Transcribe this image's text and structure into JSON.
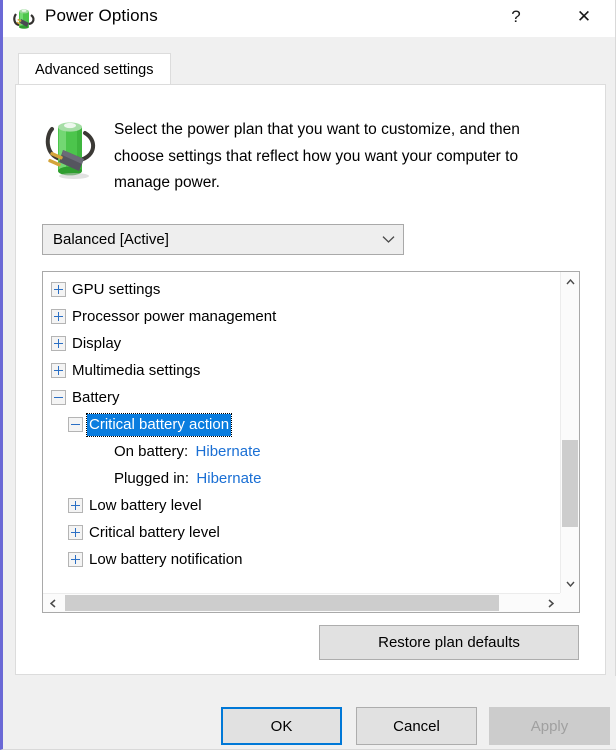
{
  "window": {
    "title": "Power Options",
    "icon": "battery-plug-icon",
    "accent_border_color": "#6b69d6",
    "caption_buttons": [
      {
        "name": "help-button",
        "glyph": "?"
      },
      {
        "name": "close-button",
        "glyph": "✕"
      }
    ]
  },
  "tabs": [
    {
      "label": "Advanced settings",
      "selected": true
    }
  ],
  "header": {
    "icon": "battery-plug-icon",
    "description": "Select the power plan that you want to customize, and then choose settings that reflect how you want your computer to manage power."
  },
  "plan_combo": {
    "value": "Balanced [Active]",
    "arrow_icon": "chevron-down-icon"
  },
  "tree": {
    "selection_color": "#0a7ddf",
    "value_link_color": "#1a6fd4",
    "items": [
      {
        "label": "GPU settings",
        "level": 0,
        "expander": "plus",
        "selected": false,
        "type": "category"
      },
      {
        "label": "Processor power management",
        "level": 0,
        "expander": "plus",
        "selected": false,
        "type": "category"
      },
      {
        "label": "Display",
        "level": 0,
        "expander": "plus",
        "selected": false,
        "type": "category"
      },
      {
        "label": "Multimedia settings",
        "level": 0,
        "expander": "plus",
        "selected": false,
        "type": "category"
      },
      {
        "label": "Battery",
        "level": 0,
        "expander": "minus",
        "selected": false,
        "type": "category"
      },
      {
        "label": "Critical battery action",
        "level": 1,
        "expander": "minus",
        "selected": true,
        "type": "setting"
      },
      {
        "label": "On battery:",
        "value": "Hibernate",
        "level": 2,
        "expander": "none",
        "selected": false,
        "type": "value"
      },
      {
        "label": "Plugged in:",
        "value": "Hibernate",
        "level": 2,
        "expander": "none",
        "selected": false,
        "type": "value"
      },
      {
        "label": "Low battery level",
        "level": 1,
        "expander": "plus",
        "selected": false,
        "type": "setting"
      },
      {
        "label": "Critical battery level",
        "level": 1,
        "expander": "plus",
        "selected": false,
        "type": "setting"
      },
      {
        "label": "Low battery notification",
        "level": 1,
        "expander": "plus",
        "selected": false,
        "type": "setting"
      }
    ]
  },
  "scrollbars": {
    "vertical": {
      "up_arrow": "⌃",
      "down_arrow": "⌄"
    },
    "horizontal": {
      "left_arrow": "‹",
      "right_arrow": "›"
    }
  },
  "restore_button": {
    "label": "Restore plan defaults"
  },
  "dialog_buttons": {
    "ok": {
      "label": "OK",
      "default": true
    },
    "cancel": {
      "label": "Cancel",
      "default": false
    },
    "apply": {
      "label": "Apply",
      "disabled": true
    }
  }
}
